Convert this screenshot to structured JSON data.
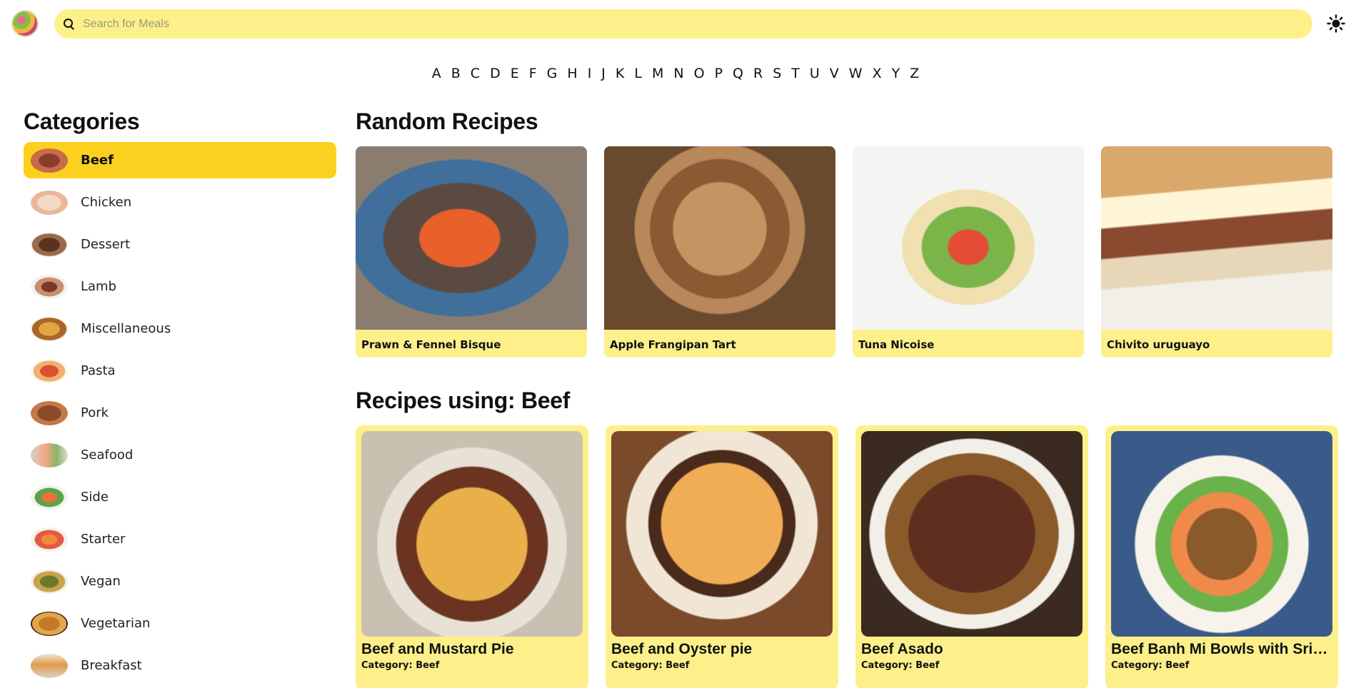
{
  "search": {
    "placeholder": "Search for Meals"
  },
  "alphabet": [
    "A",
    "B",
    "C",
    "D",
    "E",
    "F",
    "G",
    "H",
    "I",
    "J",
    "K",
    "L",
    "M",
    "N",
    "O",
    "P",
    "Q",
    "R",
    "S",
    "T",
    "U",
    "V",
    "W",
    "X",
    "Y",
    "Z"
  ],
  "sidebar": {
    "title": "Categories",
    "items": [
      {
        "label": "Beef",
        "active": true
      },
      {
        "label": "Chicken"
      },
      {
        "label": "Dessert"
      },
      {
        "label": "Lamb"
      },
      {
        "label": "Miscellaneous"
      },
      {
        "label": "Pasta"
      },
      {
        "label": "Pork"
      },
      {
        "label": "Seafood"
      },
      {
        "label": "Side"
      },
      {
        "label": "Starter"
      },
      {
        "label": "Vegan"
      },
      {
        "label": "Vegetarian"
      },
      {
        "label": "Breakfast"
      }
    ]
  },
  "random": {
    "title": "Random Recipes",
    "cards": [
      {
        "name": "Prawn & Fennel Bisque"
      },
      {
        "name": "Apple Frangipan Tart"
      },
      {
        "name": "Tuna Nicoise"
      },
      {
        "name": "Chivito uruguayo"
      }
    ]
  },
  "by_category": {
    "title": "Recipes using: Beef",
    "cards": [
      {
        "name": "Beef and Mustard Pie",
        "category": "Category: Beef"
      },
      {
        "name": "Beef and Oyster pie",
        "category": "Category: Beef"
      },
      {
        "name": "Beef Asado",
        "category": "Category: Beef"
      },
      {
        "name": "Beef Banh Mi Bowls with Sriracha Mayo, Carrot & Pickled Cucumber",
        "category": "Category: Beef"
      }
    ]
  },
  "colors": {
    "accent": "#fcd01f",
    "card_background": "#fdf08b",
    "search_background": "#fdf08b"
  }
}
